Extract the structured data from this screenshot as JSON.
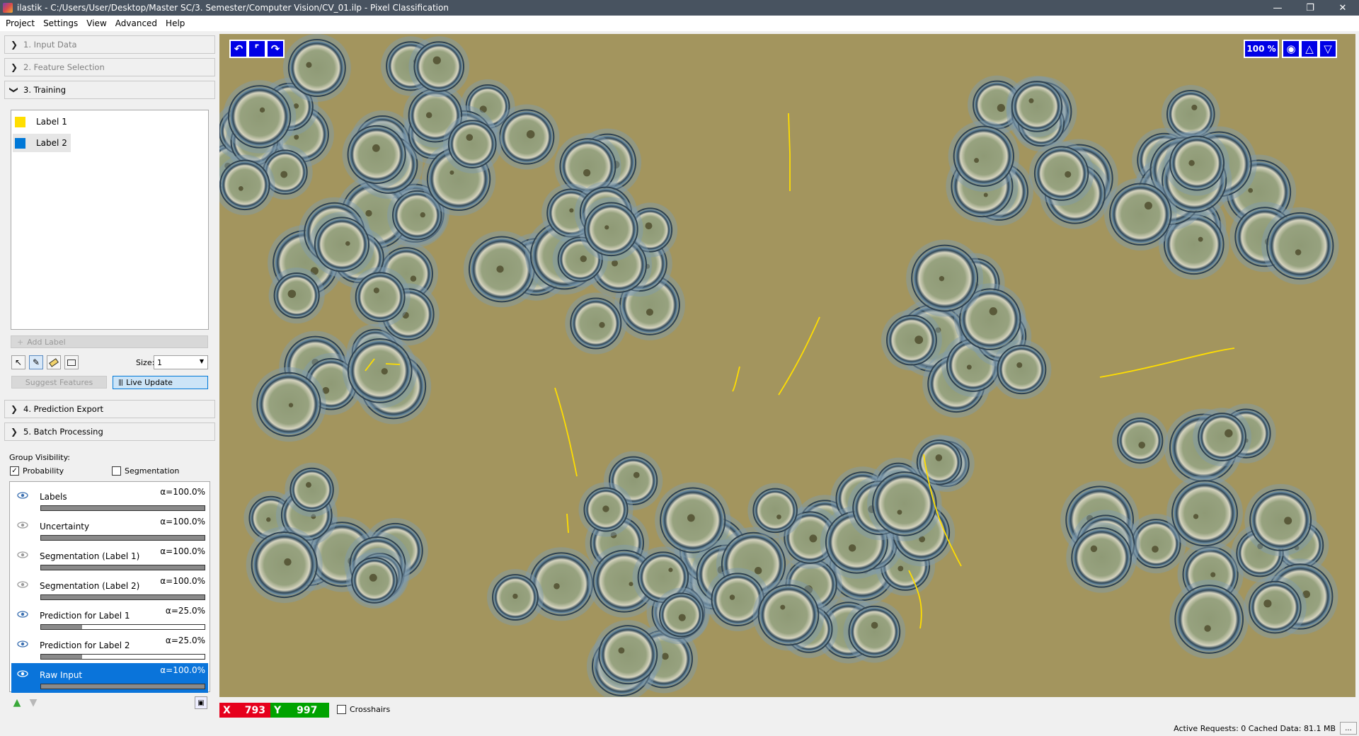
{
  "window": {
    "title": "ilastik - C:/Users/User/Desktop/Master SC/3. Semester/Computer Vision/CV_01.ilp - Pixel Classification",
    "minimize": "—",
    "restore": "❐",
    "close": "✕"
  },
  "menu": [
    "Project",
    "Settings",
    "View",
    "Advanced",
    "Help"
  ],
  "applets": [
    {
      "label": "1. Input Data",
      "expanded": false
    },
    {
      "label": "2. Feature Selection",
      "expanded": false
    },
    {
      "label": "3. Training",
      "expanded": true
    },
    {
      "label": "4. Prediction Export",
      "expanded": false
    },
    {
      "label": "5. Batch Processing",
      "expanded": false
    }
  ],
  "labels": [
    {
      "name": "Label 1",
      "color": "#ffde00"
    },
    {
      "name": "Label 2",
      "color": "#0078d7"
    }
  ],
  "training": {
    "add_label": "Add Label",
    "size_label": "Size:",
    "size_value": "1",
    "suggest_features": "Suggest Features",
    "live_update": "Live Update"
  },
  "group_visibility": {
    "title": "Group Visibility:",
    "probability": "Probability",
    "probability_checked": true,
    "segmentation": "Segmentation",
    "segmentation_checked": false
  },
  "layers": [
    {
      "name": "Labels",
      "opacity_text": "α=100.0%",
      "opacity": 1.0,
      "visible": true
    },
    {
      "name": "Uncertainty",
      "opacity_text": "α=100.0%",
      "opacity": 1.0,
      "visible": false
    },
    {
      "name": "Segmentation (Label 1)",
      "opacity_text": "α=100.0%",
      "opacity": 1.0,
      "visible": false
    },
    {
      "name": "Segmentation (Label 2)",
      "opacity_text": "α=100.0%",
      "opacity": 1.0,
      "visible": false
    },
    {
      "name": "Prediction for Label 1",
      "opacity_text": "α=25.0%",
      "opacity": 0.25,
      "visible": true
    },
    {
      "name": "Prediction for Label 2",
      "opacity_text": "α=25.0%",
      "opacity": 0.25,
      "visible": true
    },
    {
      "name": "Raw Input",
      "opacity_text": "α=100.0%",
      "opacity": 1.0,
      "visible": true,
      "selected": true
    }
  ],
  "viewer": {
    "zoom": "100 %"
  },
  "coords": {
    "x_label": "X",
    "x_value": "793",
    "y_label": "Y",
    "y_value": "997",
    "crosshairs": "Crosshairs"
  },
  "status": {
    "text": "Active Requests: 0  Cached Data: 81.1 MB",
    "button": "..."
  }
}
